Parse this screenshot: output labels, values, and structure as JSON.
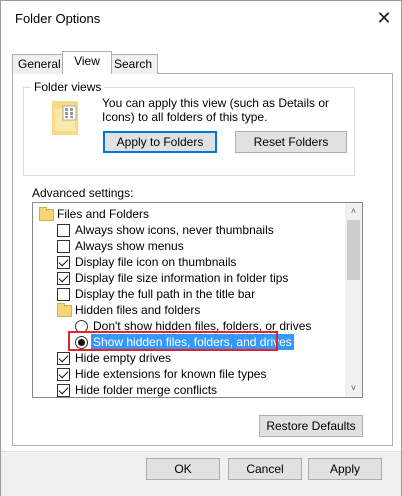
{
  "window": {
    "title": "Folder Options",
    "close_glyph": "✕"
  },
  "tabs": [
    {
      "label": "General",
      "active": false
    },
    {
      "label": "View",
      "active": true
    },
    {
      "label": "Search",
      "active": false
    }
  ],
  "folder_views": {
    "legend": "Folder views",
    "description": "You can apply this view (such as Details or Icons) to all folders of this type.",
    "icon": "folder-view-icon",
    "apply_label": "Apply to Folders",
    "reset_label": "Reset Folders"
  },
  "advanced": {
    "label": "Advanced settings:",
    "items": [
      {
        "type": "folder",
        "label": "Files and Folders"
      },
      {
        "type": "checkbox",
        "checked": false,
        "label": "Always show icons, never thumbnails"
      },
      {
        "type": "checkbox",
        "checked": false,
        "label": "Always show menus"
      },
      {
        "type": "checkbox",
        "checked": true,
        "label": "Display file icon on thumbnails"
      },
      {
        "type": "checkbox",
        "checked": true,
        "label": "Display file size information in folder tips"
      },
      {
        "type": "checkbox",
        "checked": false,
        "label": "Display the full path in the title bar"
      },
      {
        "type": "folder",
        "label": "Hidden files and folders"
      },
      {
        "type": "radio",
        "checked": false,
        "label": "Don't show hidden files, folders, or drives"
      },
      {
        "type": "radio",
        "checked": true,
        "label": "Show hidden files, folders, and drives"
      },
      {
        "type": "checkbox",
        "checked": true,
        "label": "Hide empty drives"
      },
      {
        "type": "checkbox",
        "checked": true,
        "label": "Hide extensions for known file types"
      },
      {
        "type": "checkbox",
        "checked": true,
        "label": "Hide folder merge conflicts"
      }
    ],
    "selection_color": "#3399ff",
    "highlight_color": "#e3232b"
  },
  "restore_defaults_label": "Restore Defaults",
  "footer": {
    "ok_label": "OK",
    "cancel_label": "Cancel",
    "apply_label": "Apply"
  }
}
